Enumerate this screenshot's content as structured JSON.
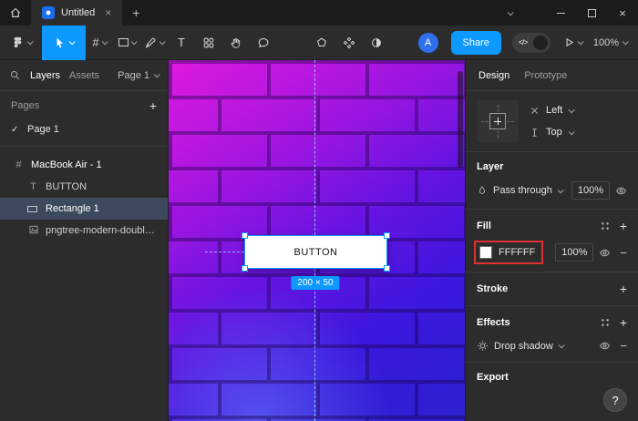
{
  "glyphs": {
    "plus": "+",
    "minus": "−",
    "close": "×",
    "check": "✓",
    "frame": "#",
    "text": "T",
    "devmode": "</>",
    "question": "?"
  },
  "titlebar": {
    "tab_title": "Untitled"
  },
  "toolbar": {
    "avatar_initial": "A",
    "share_label": "Share",
    "zoom_level": "100%"
  },
  "left_sidebar": {
    "tab_layers": "Layers",
    "tab_assets": "Assets",
    "page_selector": "Page 1",
    "pages_header": "Pages",
    "page_item": "Page 1",
    "layers": [
      {
        "label": "MacBook Air - 1"
      },
      {
        "label": "BUTTON"
      },
      {
        "label": "Rectangle 1"
      },
      {
        "label": "pngtree-modern-double-color..."
      }
    ]
  },
  "canvas": {
    "button_label": "BUTTON",
    "size_badge": "200 × 50"
  },
  "inspector": {
    "tab_design": "Design",
    "tab_prototype": "Prototype",
    "align_x": "Left",
    "align_y": "Top",
    "layer_header": "Layer",
    "blend_mode": "Pass through",
    "layer_opacity": "100%",
    "fill_header": "Fill",
    "fill_hex": "FFFFFF",
    "fill_opacity": "100%",
    "stroke_header": "Stroke",
    "effects_header": "Effects",
    "effect_name": "Drop shadow",
    "export_header": "Export",
    "help_label": "?"
  },
  "colors": {
    "accent": "#0d99ff",
    "fill_swatch": "#ffffff",
    "annotation_red": "#e03131",
    "selected_layer_bg": "#3d4a5e"
  }
}
